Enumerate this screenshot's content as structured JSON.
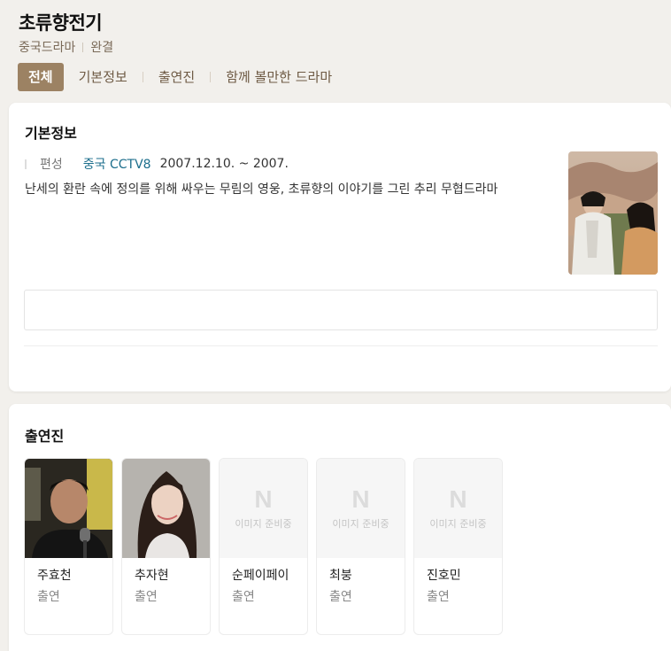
{
  "header": {
    "title": "초류향전기",
    "genre": "중국드라마",
    "status": "완결"
  },
  "tabs": [
    {
      "label": "전체",
      "active": true
    },
    {
      "label": "기본정보",
      "active": false
    },
    {
      "label": "출연진",
      "active": false
    },
    {
      "label": "함께 볼만한 드라마",
      "active": false
    }
  ],
  "basic_info": {
    "section_title": "기본정보",
    "meta_label": "편성",
    "channel": "중국 CCTV8",
    "period": "2007.12.10. ~ 2007.",
    "description": "난세의 환란 속에 정의를 위해 싸우는 무림의 영웅, 초류향의 이야기를 그린 추리 무협드라마"
  },
  "cast": {
    "section_title": "출연진",
    "placeholder_letter": "N",
    "placeholder_text": "이미지 준비중",
    "members": [
      {
        "name": "주효천",
        "role": "출연",
        "has_photo": true
      },
      {
        "name": "추자현",
        "role": "출연",
        "has_photo": true
      },
      {
        "name": "순페이페이",
        "role": "출연",
        "has_photo": false
      },
      {
        "name": "최붕",
        "role": "출연",
        "has_photo": false
      },
      {
        "name": "진호민",
        "role": "출연",
        "has_photo": false
      }
    ]
  },
  "colors": {
    "accent": "#9c8263",
    "link": "#1c6e8c",
    "background": "#f2f0ec"
  }
}
